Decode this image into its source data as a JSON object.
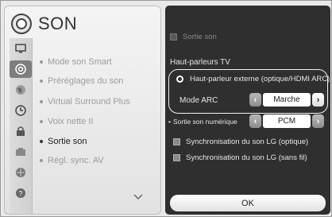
{
  "header": {
    "title": "SON"
  },
  "categories": [
    {
      "icon": "tv-icon"
    },
    {
      "icon": "sound-icon"
    },
    {
      "icon": "globe-icon"
    },
    {
      "icon": "clock-icon"
    },
    {
      "icon": "lock-icon"
    },
    {
      "icon": "option-icon"
    },
    {
      "icon": "network-icon"
    },
    {
      "icon": "support-icon"
    }
  ],
  "menu": {
    "items": [
      {
        "label": "Mode son Smart"
      },
      {
        "label": "Préréglages du son"
      },
      {
        "label": "Virtual Surround Plus"
      },
      {
        "label": "Voix nette II"
      },
      {
        "label": "Sortie son"
      },
      {
        "label": "Régl. sync. AV"
      }
    ]
  },
  "panel": {
    "top_checkbox": "Sortie son",
    "section_label": "Haut-parleurs TV",
    "radio_label": "Haut-parleur externe (optique/HDMI ARC)",
    "arc": {
      "label": "Mode ARC",
      "value": "Marche"
    },
    "digital": {
      "label": "Sortie son numérique",
      "value": "PCM"
    },
    "sync_optical": "Synchronisation du son LG (optique)",
    "sync_wireless": "Synchronisation du son LG (sans fil)",
    "ok_label": "OK"
  },
  "colors": {
    "panel_bg": "#2f2f2f",
    "accent": "#ffffff"
  }
}
